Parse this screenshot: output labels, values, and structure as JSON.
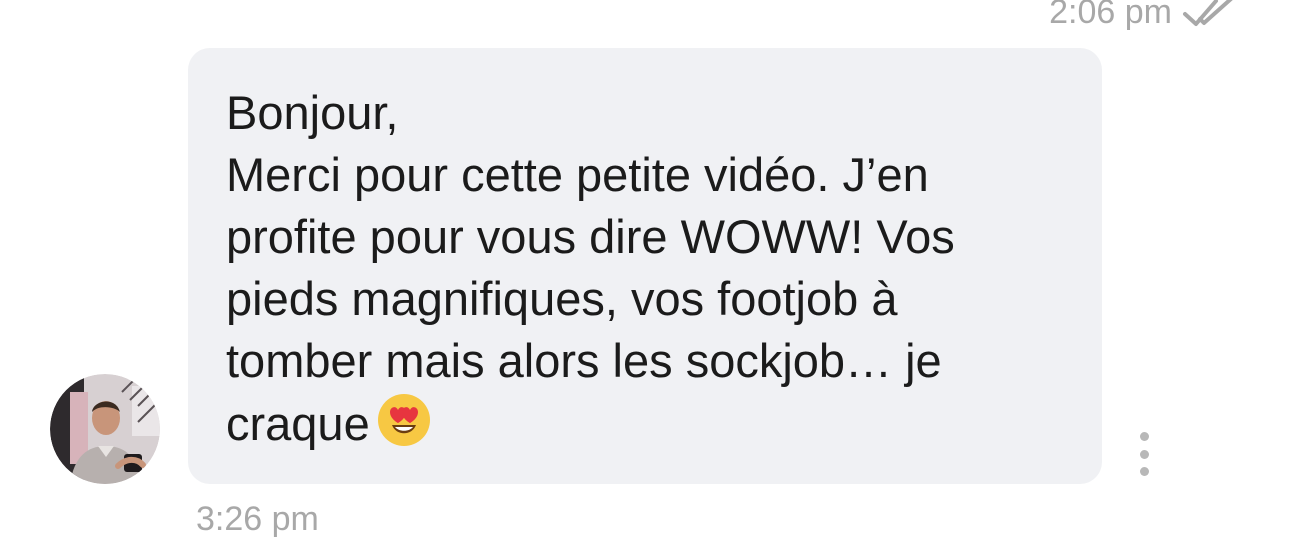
{
  "thread": {
    "previous_message": {
      "time": "2:06 pm",
      "status_icon": "double-check-icon"
    },
    "message": {
      "avatar_icon": "avatar-photo",
      "text": "Bonjour,\nMerci pour cette petite vidéo. J’en\nprofite pour vous dire WOWW! Vos\npieds magnifiques, vos footjob à\ntomber mais alors les sockjob… je\ncraque",
      "emoji": "heart-eyes-emoji",
      "time": "3:26 pm"
    },
    "actions": {
      "more_icon": "more-vert-icon"
    }
  }
}
